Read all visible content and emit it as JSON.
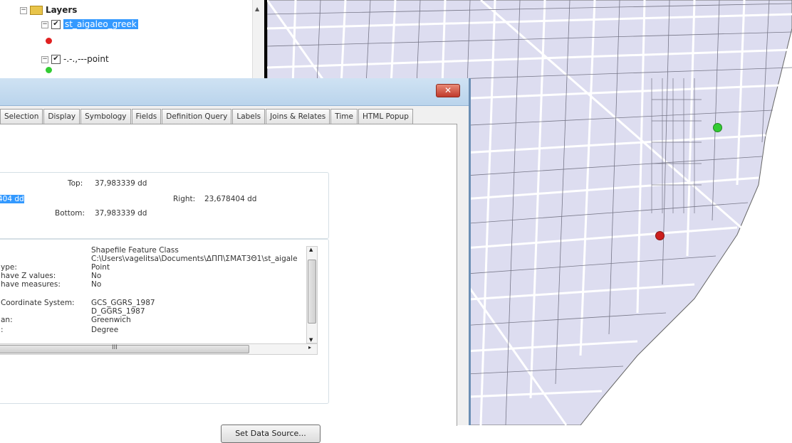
{
  "toc": {
    "root_label": "Layers",
    "layers": [
      {
        "name": "st_aigaleo_greek",
        "checked": true,
        "symbol_color": "#e02020",
        "selected": true
      },
      {
        "name": "-.-.,---point",
        "checked": true,
        "symbol_color": "#33cc33",
        "selected": false
      }
    ]
  },
  "dialog": {
    "title": "",
    "close_icon": "close-icon",
    "tabs": [
      "Selection",
      "Display",
      "Symbology",
      "Fields",
      "Definition Query",
      "Labels",
      "Joins & Relates",
      "Time",
      "HTML Popup"
    ],
    "extent": {
      "top_label": "Top:",
      "top_value": "37,983339 dd",
      "left_value": "404 dd",
      "right_label": "Right:",
      "right_value": "23,678404 dd",
      "bottom_label": "Bottom:",
      "bottom_value": "37,983339 dd"
    },
    "info_rows": [
      {
        "label": "",
        "value": "Shapefile Feature Class"
      },
      {
        "label": "",
        "value": "C:\\Users\\vagelitsa\\Documents\\ΔΠΠ\\ΣΜΑΤ3Θ1\\st_aigale"
      },
      {
        "label": "ype:",
        "value": "Point"
      },
      {
        "label": "have Z values:",
        "value": "No"
      },
      {
        "label": "have measures:",
        "value": "No"
      },
      {
        "label": "",
        "value": ""
      },
      {
        "label": "Coordinate System:",
        "value": "GCS_GGRS_1987"
      },
      {
        "label": "",
        "value": "D_GGRS_1987"
      },
      {
        "label": "an:",
        "value": "Greenwich"
      },
      {
        "label": ":",
        "value": "Degree"
      }
    ],
    "hscroll_thumb_label": "III",
    "set_data_source_label": "Set Data Source..."
  },
  "map": {
    "background_color": "#ddddf0",
    "line_color": "#6f6f7f",
    "points": [
      {
        "name": "green-point",
        "color": "#33cc33"
      },
      {
        "name": "red-point",
        "color": "#cc1f1f"
      }
    ]
  }
}
